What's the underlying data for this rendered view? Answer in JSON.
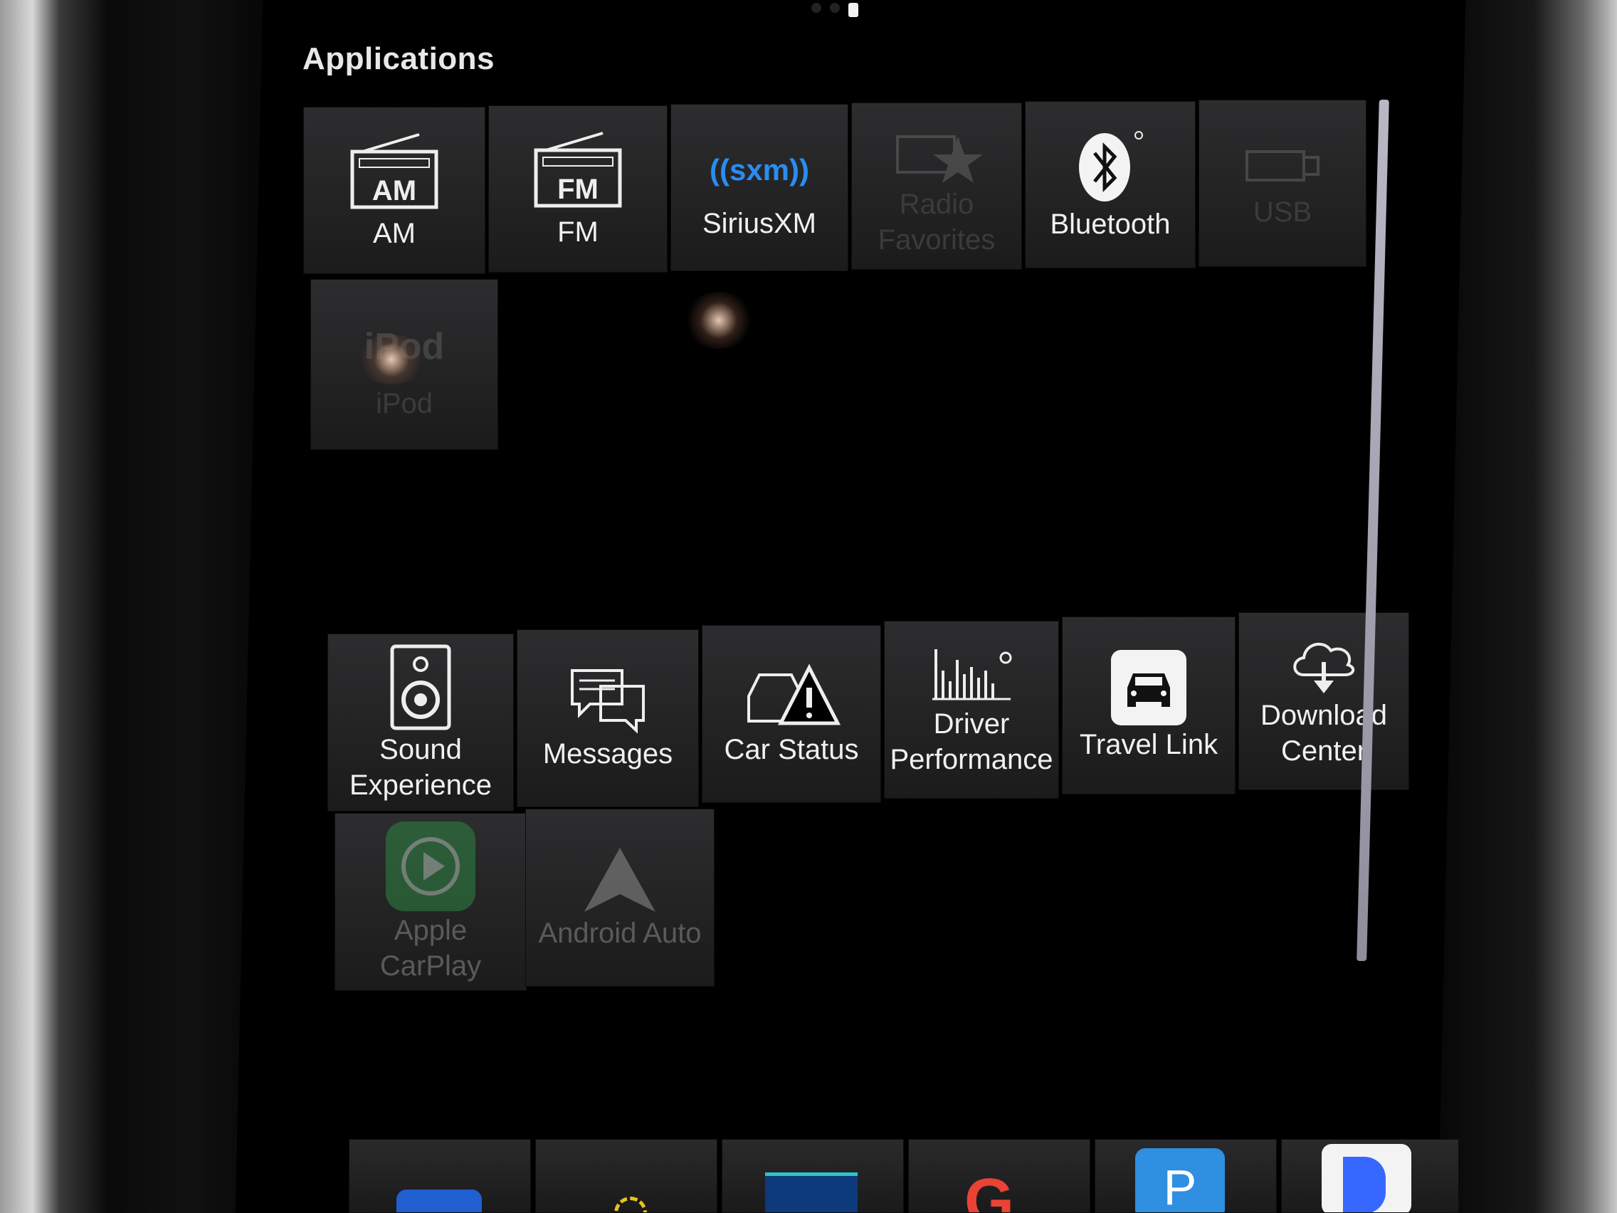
{
  "header": {
    "title": "Applications"
  },
  "apps_top": [
    {
      "id": "am",
      "label": "AM",
      "icon": "am-radio-icon",
      "icon_text": "AM",
      "enabled": true
    },
    {
      "id": "fm",
      "label": "FM",
      "icon": "fm-radio-icon",
      "icon_text": "FM",
      "enabled": true
    },
    {
      "id": "siriusxm",
      "label": "SiriusXM",
      "icon": "siriusxm-logo-icon",
      "icon_text": "((sxm))",
      "enabled": true
    },
    {
      "id": "radio-favorites",
      "label": "Radio Favorites",
      "icon": "radio-star-icon",
      "enabled": false
    },
    {
      "id": "bluetooth",
      "label": "Bluetooth",
      "icon": "bluetooth-icon",
      "enabled": true
    },
    {
      "id": "usb",
      "label": "USB",
      "icon": "usb-icon",
      "enabled": false
    },
    {
      "id": "ipod",
      "label": "iPod",
      "icon": "ipod-icon",
      "icon_text": "iPod",
      "enabled": false
    }
  ],
  "apps_bottom": [
    {
      "id": "sound-experience",
      "label": "Sound Experience",
      "icon": "speaker-icon",
      "enabled": true
    },
    {
      "id": "messages",
      "label": "Messages",
      "icon": "messages-icon",
      "enabled": true
    },
    {
      "id": "car-status",
      "label": "Car Status",
      "icon": "car-warning-icon",
      "enabled": true
    },
    {
      "id": "driver-performance",
      "label": "Driver Performance",
      "icon": "bar-graph-icon",
      "enabled": true
    },
    {
      "id": "travel-link",
      "label": "Travel Link",
      "icon": "car-front-icon",
      "enabled": true
    },
    {
      "id": "download-center",
      "label": "Download Center",
      "icon": "cloud-download-icon",
      "enabled": true
    },
    {
      "id": "apple-carplay",
      "label": "Apple CarPlay",
      "icon": "carplay-icon",
      "enabled": false
    },
    {
      "id": "android-auto",
      "label": "Android Auto",
      "icon": "android-auto-icon",
      "enabled": false
    }
  ],
  "dock": [
    {
      "icon": "refresh-app-icon",
      "color": "#1f5fd0"
    },
    {
      "icon": "sun-app-icon",
      "color": "#e8c21c"
    },
    {
      "icon": "tunein-app-icon",
      "color": "#2ec4c4"
    },
    {
      "icon": "google-app-icon",
      "color": "#ea4335"
    },
    {
      "icon": "parking-app-icon",
      "color": "#2f8fe0",
      "icon_text": "P"
    },
    {
      "icon": "pandora-app-icon",
      "color": "#3668ff"
    }
  ],
  "colors": {
    "tile_top": "#2d2d2f",
    "tile_bottom": "#1b1b1c",
    "text": "#f1f1f1",
    "disabled_text": "#3b3b3e",
    "siriusxm_blue": "#2a8df0",
    "carplay_green": "#2f9a46"
  }
}
